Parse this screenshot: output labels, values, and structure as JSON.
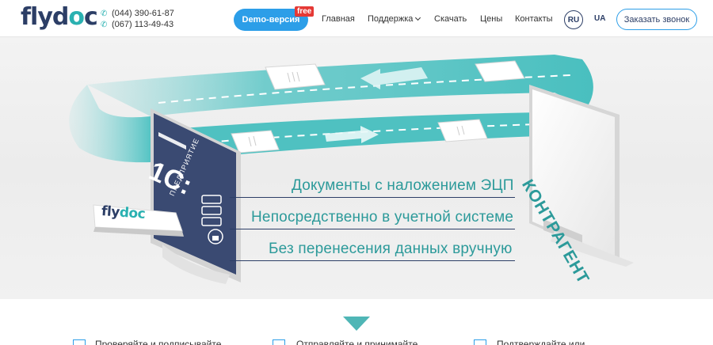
{
  "header": {
    "logo": {
      "part1": "fly",
      "part2": "d",
      "part3": "o",
      "part4": "c"
    },
    "phones": [
      "(044) 390-61-87",
      "(067) 113-49-43"
    ],
    "demo_label": "Demo-версия",
    "free_badge": "free",
    "nav": {
      "home": "Главная",
      "support": "Поддержка",
      "download": "Скачать",
      "prices": "Цены",
      "contacts": "Контакты"
    },
    "lang_ru": "RU",
    "lang_ua": "UA",
    "callback_label": "Заказать звонок"
  },
  "hero": {
    "lines": [
      "Документы с наложением ЭЦП",
      "Непосредственно в учетной системе",
      "Без перенесения данных вручную"
    ],
    "left_screen": {
      "brand": "1С:",
      "caption": "ПРЕДПРИЯТИЕ"
    },
    "right_screen": {
      "caption": "КОНТРАГЕНТ"
    },
    "card_logo": {
      "part1": "fly",
      "part2": "doc"
    }
  },
  "features": [
    "Проверяйте и подписывайте",
    "Отправляйте и принимайте",
    "Подтверждайте или"
  ],
  "colors": {
    "brand_dark": "#2c3e66",
    "brand_teal": "#2ab1b1",
    "accent_blue": "#2c9ee8",
    "badge_red": "#e53935"
  }
}
